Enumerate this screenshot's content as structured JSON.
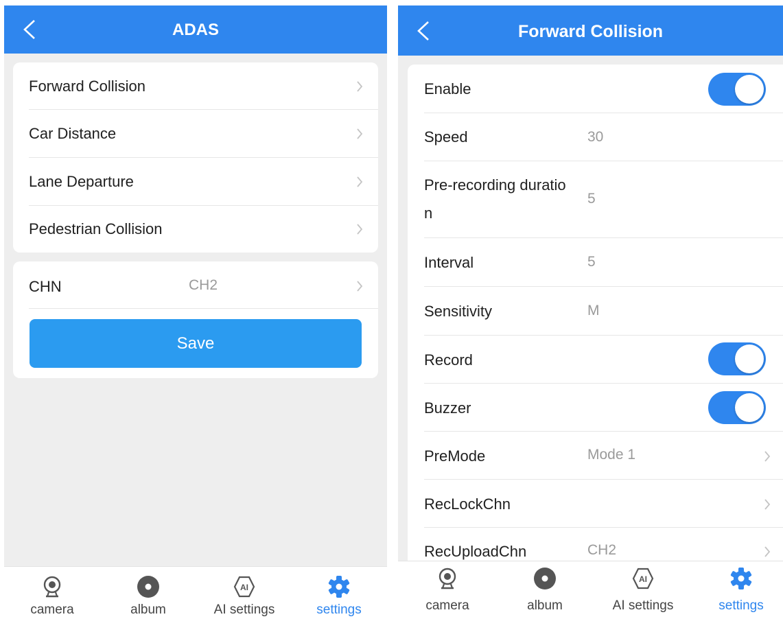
{
  "left": {
    "title": "ADAS",
    "menu": [
      {
        "label": "Forward Collision"
      },
      {
        "label": "Car Distance"
      },
      {
        "label": "Lane Departure"
      },
      {
        "label": "Pedestrian Collision"
      }
    ],
    "chn": {
      "label": "CHN",
      "value": "CH2"
    },
    "save_label": "Save"
  },
  "right": {
    "title": "Forward Collision",
    "rows": [
      {
        "label": "Enable",
        "toggle": true
      },
      {
        "label": "Speed",
        "value": "30"
      },
      {
        "label": "Pre-recording duratio",
        "label2": "n",
        "value": "5"
      },
      {
        "label": "Interval",
        "value": "5"
      },
      {
        "label": "Sensitivity",
        "value": "M"
      },
      {
        "label": "Record",
        "toggle": true
      },
      {
        "label": "Buzzer",
        "toggle": true
      },
      {
        "label": "PreMode",
        "value": "Mode 1"
      },
      {
        "label": "RecLockChn",
        "value": ""
      },
      {
        "label": "RecUploadChn",
        "value": "CH2"
      }
    ]
  },
  "tabs": [
    {
      "label": "camera",
      "icon": "camera-icon"
    },
    {
      "label": "album",
      "icon": "album-icon"
    },
    {
      "label": "AI settings",
      "icon": "ai-settings-icon"
    },
    {
      "label": "settings",
      "icon": "gear-icon",
      "active": true
    }
  ],
  "colors": {
    "accent": "#2f86ee",
    "save_button": "#2b9bf0",
    "background": "#eeeeee",
    "value_text": "#9a9a9a"
  }
}
